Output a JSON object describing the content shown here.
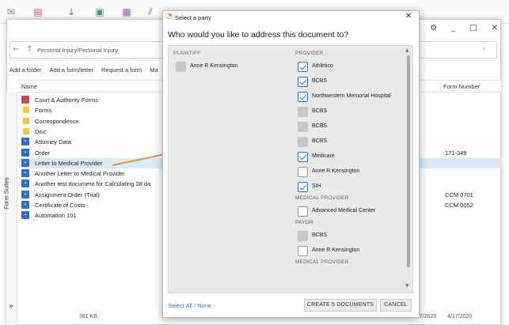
{
  "background": {
    "address": "Personal Injury/Personal Injury",
    "commands": [
      "Add a folder",
      "Add a form/letter",
      "Request a form",
      "Ma"
    ],
    "columns": {
      "name": "Name",
      "form_number": "Form Number"
    },
    "side_label": "Form Suites",
    "rows": [
      {
        "icon": "court",
        "name": "Court & Authority Forms",
        "form_number": ""
      },
      {
        "icon": "folder",
        "name": "Forms",
        "form_number": ""
      },
      {
        "icon": "folder",
        "name": "Correspondence",
        "form_number": ""
      },
      {
        "icon": "folder",
        "name": "Disc",
        "form_number": ""
      },
      {
        "icon": "doc",
        "name": "Attorney Data",
        "form_number": ""
      },
      {
        "icon": "doc",
        "name": "Order",
        "form_number": "171-349"
      },
      {
        "icon": "doc",
        "name": "Letter to Medical Provider",
        "form_number": "",
        "selected": true
      },
      {
        "icon": "doc",
        "name": "Another Letter to Medical Provider",
        "form_number": ""
      },
      {
        "icon": "doc",
        "name": "Another test document for Calculating 28 da",
        "form_number": ""
      },
      {
        "icon": "doc",
        "name": "Assignment Order (Trial)",
        "form_number": "CCM 0701"
      },
      {
        "icon": "doc",
        "name": "Certificate of Costs",
        "form_number": "CCM 0052"
      },
      {
        "icon": "doc",
        "name": "Automation 101",
        "form_number": ""
      }
    ],
    "bottom_text": "361 KB",
    "bottom_dates": [
      "4/17/2020",
      "4/17/2020"
    ]
  },
  "dialog": {
    "title": "Select a party",
    "question": "Who would you like to address this document to?",
    "plaintiff": {
      "heading": "PLAINTIFF",
      "items": [
        {
          "label": "Anne R Kensington",
          "state": "disabled"
        }
      ]
    },
    "provider": {
      "heading": "PROVIDER",
      "items": [
        {
          "label": "Athletico",
          "state": "checked"
        },
        {
          "label": "BCBS",
          "state": "checked"
        },
        {
          "label": "Northwestern Memorial Hospital",
          "state": "checked"
        },
        {
          "label": "BCBS",
          "state": "disabled"
        },
        {
          "label": "BCBS",
          "state": "disabled"
        },
        {
          "label": "BCBS",
          "state": "disabled"
        },
        {
          "label": "Medicare",
          "state": "checked"
        },
        {
          "label": "Anne R Kensington",
          "state": "unchecked"
        },
        {
          "label": "SIH",
          "state": "checked"
        }
      ]
    },
    "medical_provider": {
      "heading": "MEDICAL PROVIDER",
      "items": [
        {
          "label": "Advanced Medical Center",
          "state": "unchecked"
        }
      ]
    },
    "payor": {
      "heading": "PAYOR",
      "items": [
        {
          "label": "BCBS",
          "state": "disabled"
        },
        {
          "label": "Anne R Kensington",
          "state": "unchecked"
        }
      ]
    },
    "medical_provider_2": {
      "heading": "MEDICAL PROVIDER"
    },
    "select_all": "Select All",
    "separator": "/",
    "select_none": "None",
    "create_button": "CREATE 5 DOCUMENTS",
    "cancel_button": "CANCEL"
  },
  "colors": {
    "accent": "#2f77c9",
    "arrow": "#e8904a",
    "selected_row": "#d9ebf9",
    "logo": "#e8772e"
  }
}
